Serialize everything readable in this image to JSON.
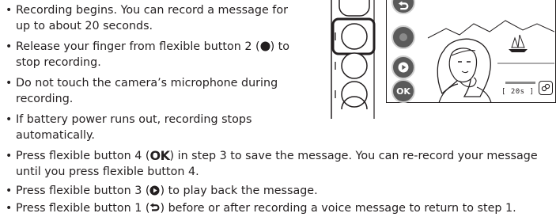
{
  "upper_bullets": [
    "Recording begins. You can record a message for",
    "up to about 20 seconds.",
    {
      "before": "Release your finger from flexible button 2 (",
      "after": ") to"
    },
    "stop recording.",
    "Do not touch the camera’s microphone during",
    "recording.",
    "If battery power runs out, recording stops",
    "automatically."
  ],
  "lower_bullets": {
    "b1_before": "Press flexible button 4 (",
    "b1_after": ") in step 3 to save the message. You can re-record your message",
    "b1_cont": "until you press flexible button 4.",
    "b2_before": "Press flexible button 3 (",
    "b2_after": ") to play back the message.",
    "b3_before": "Press flexible button 1 (",
    "b3_after": ") before or after recording a voice message to return to step 1."
  },
  "symbols": {
    "ok": "OK",
    "record_icon": "filled-circle-icon",
    "play_icon": "play-circle-icon",
    "back_icon": "back-arrow-icon"
  },
  "screen": {
    "ok_button": "OK",
    "timer": "[ 20s ]",
    "colors": {
      "button_fill": "#5a5a5a",
      "button_ring": "#cfcfcf",
      "outline": "#231f20"
    }
  }
}
